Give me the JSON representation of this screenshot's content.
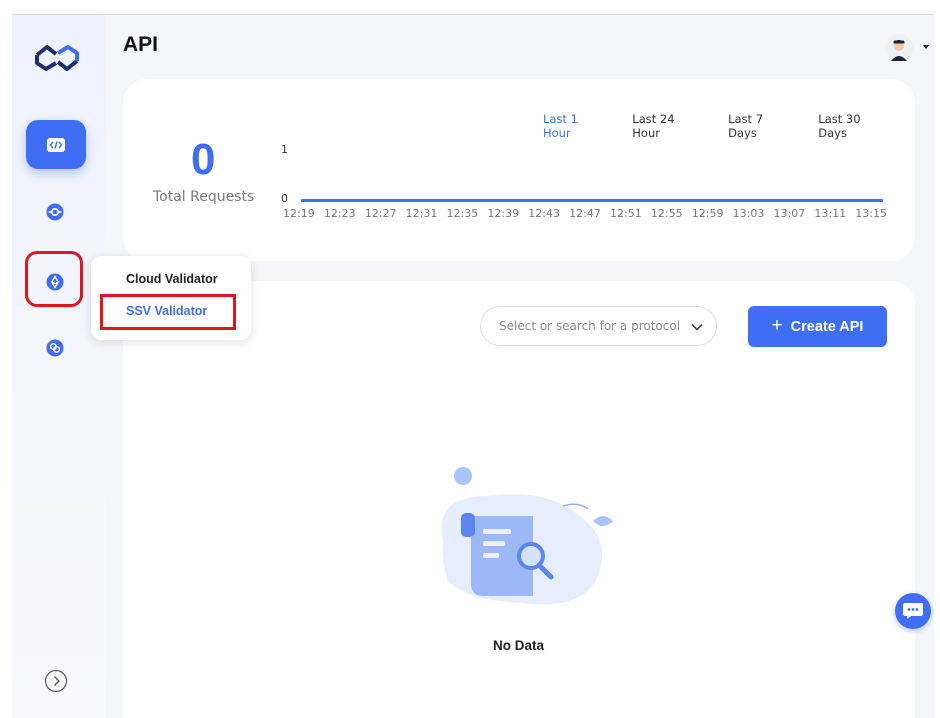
{
  "page": {
    "title": "API"
  },
  "sidebar": {
    "items": [
      {
        "name": "api",
        "icon": "code-icon",
        "active": true
      },
      {
        "name": "node",
        "icon": "node-icon",
        "active": false
      },
      {
        "name": "validator",
        "icon": "ethereum-icon",
        "active": false,
        "highlighted": true
      },
      {
        "name": "link",
        "icon": "link-icon",
        "active": false
      }
    ]
  },
  "stats": {
    "total_value": "0",
    "total_label": "Total Requests",
    "ranges": [
      "Last 1 Hour",
      "Last 24 Hour",
      "Last 7 Days",
      "Last 30 Days"
    ],
    "active_range": "Last 1 Hour"
  },
  "chart_data": {
    "type": "line",
    "x": [
      "12:19",
      "12:23",
      "12:27",
      "12:31",
      "12:35",
      "12:39",
      "12:43",
      "12:47",
      "12:51",
      "12:55",
      "12:59",
      "13:03",
      "13:07",
      "13:11",
      "13:15"
    ],
    "series": [
      {
        "values": [
          0,
          0,
          0,
          0,
          0,
          0,
          0,
          0,
          0,
          0,
          0,
          0,
          0,
          0,
          0
        ]
      }
    ],
    "yticks": [
      "1",
      "0"
    ],
    "ylim": [
      0,
      1
    ],
    "color": "#3f6ef5"
  },
  "toolbar": {
    "protocol_placeholder": "Select or search for a protocol",
    "create_plus": "+",
    "create_label": "Create API"
  },
  "empty_state": {
    "text": "No Data"
  },
  "popover": {
    "items": [
      "Cloud Validator",
      "SSV Validator"
    ],
    "highlighted": "SSV Validator"
  },
  "colors": {
    "accent": "#3f6ef5",
    "highlight": "#e0161b"
  }
}
